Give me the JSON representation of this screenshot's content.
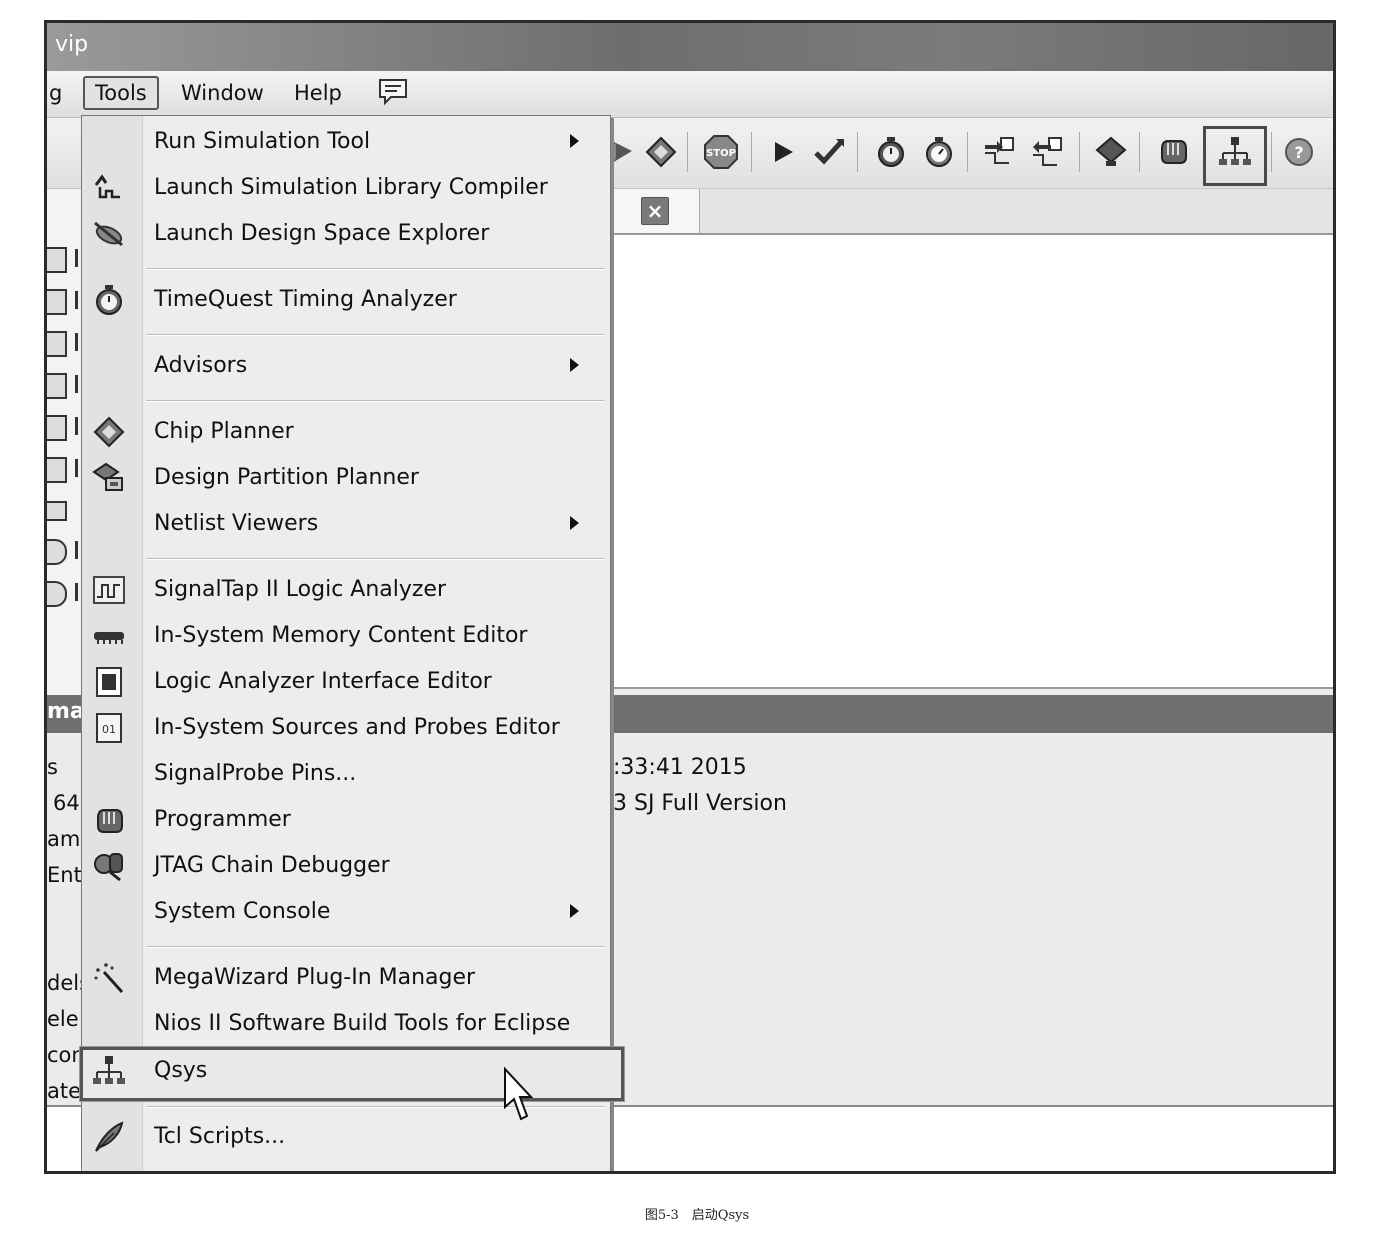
{
  "window": {
    "title": "vip"
  },
  "menubar": {
    "items": [
      {
        "label": "g"
      },
      {
        "label": "Tools"
      },
      {
        "label": "Window"
      },
      {
        "label": "Help"
      }
    ]
  },
  "toolbar": {
    "icons": [
      "compile-icon",
      "chip-icon",
      "stop-icon",
      "play-icon",
      "check-arrow-icon",
      "timer-icon",
      "stopwatch-icon",
      "netlist-forward-icon",
      "netlist-back-icon",
      "diamond-icon",
      "programmer-hand-icon",
      "qsys-icon",
      "help-icon"
    ],
    "stop_label": "STOP"
  },
  "tab": {
    "close_label": "×"
  },
  "left_fragments": {
    "msg_header": "ma",
    "rows": [
      "s",
      "64",
      "am",
      "Enti",
      "dels",
      "ele",
      "com",
      "ated"
    ]
  },
  "messages": {
    "line1": ":33:41 2015",
    "line2": "3 SJ Full Version"
  },
  "tools_menu": {
    "items": [
      {
        "label": "Run Simulation Tool",
        "submenu": true,
        "icon": ""
      },
      {
        "label": "Launch Simulation Library Compiler",
        "icon": "library-compiler-icon"
      },
      {
        "label": "Launch Design Space Explorer",
        "icon": "design-space-explorer-icon"
      },
      {
        "label": "TimeQuest Timing Analyzer",
        "icon": "stopwatch-icon"
      },
      {
        "label": "Advisors",
        "submenu": true,
        "icon": ""
      },
      {
        "label": "Chip Planner",
        "icon": "chip-planner-icon"
      },
      {
        "label": "Design Partition Planner",
        "icon": "partition-planner-icon"
      },
      {
        "label": "Netlist Viewers",
        "submenu": true,
        "icon": ""
      },
      {
        "label": "SignalTap II Logic Analyzer",
        "icon": "signaltap-icon"
      },
      {
        "label": "In-System Memory Content Editor",
        "icon": "memory-icon"
      },
      {
        "label": "Logic Analyzer Interface Editor",
        "icon": "logic-analyzer-icon"
      },
      {
        "label": "In-System Sources and Probes Editor",
        "icon": "sources-probes-icon"
      },
      {
        "label": "SignalProbe Pins...",
        "icon": ""
      },
      {
        "label": "Programmer",
        "icon": "programmer-icon"
      },
      {
        "label": "JTAG Chain Debugger",
        "icon": "jtag-icon"
      },
      {
        "label": "System Console",
        "submenu": true,
        "icon": ""
      },
      {
        "label": "MegaWizard Plug-In Manager",
        "icon": "magic-wand-icon"
      },
      {
        "label": "Nios II Software Build Tools for Eclipse",
        "icon": ""
      },
      {
        "label": "Qsys",
        "icon": "qsys-icon",
        "highlighted": true
      },
      {
        "label": "Tcl Scripts...",
        "icon": "feather-icon"
      }
    ]
  },
  "caption": "图5-3　启动Qsys"
}
